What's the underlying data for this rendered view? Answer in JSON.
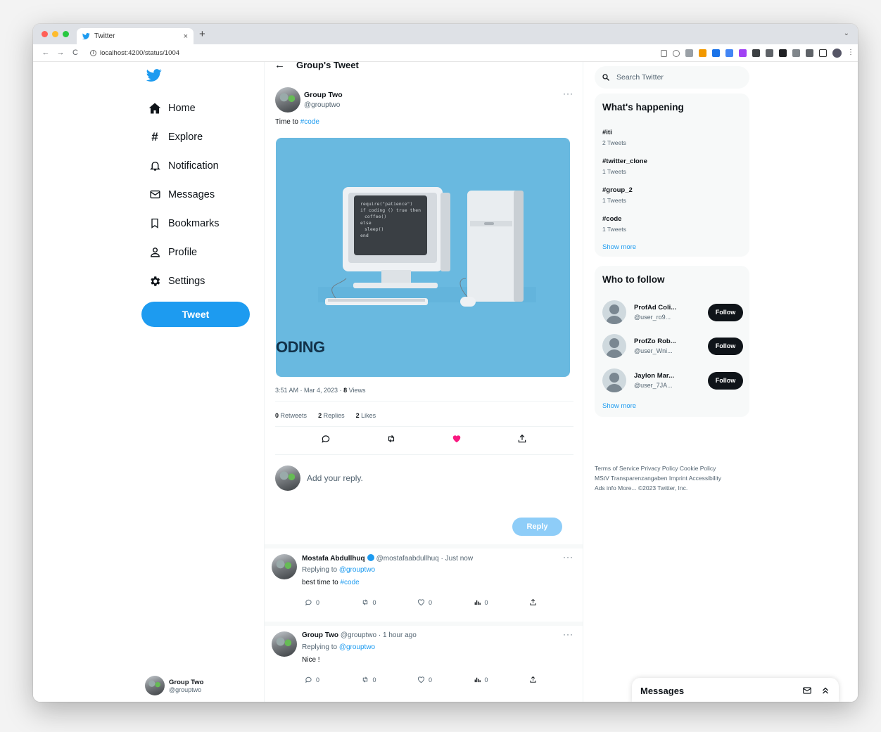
{
  "browser": {
    "tab_title": "Twitter",
    "new_tab": "+",
    "tab_close": "×",
    "url": "localhost:4200/status/1004"
  },
  "nav": {
    "items": [
      {
        "label": "Home",
        "icon": "home-icon"
      },
      {
        "label": "Explore",
        "icon": "hashtag-icon"
      },
      {
        "label": "Notification",
        "icon": "bell-icon"
      },
      {
        "label": "Messages",
        "icon": "envelope-icon"
      },
      {
        "label": "Bookmarks",
        "icon": "bookmark-icon"
      },
      {
        "label": "Profile",
        "icon": "user-icon"
      },
      {
        "label": "Settings",
        "icon": "gear-icon"
      }
    ],
    "tweet_button": "Tweet"
  },
  "account": {
    "name": "Group Two",
    "handle": "@grouptwo"
  },
  "header": {
    "title": "Group's Tweet"
  },
  "post": {
    "author_name": "Group Two",
    "author_handle": "@grouptwo",
    "text_prefix": "Time to ",
    "hashtag": "#code",
    "image_caption": "ODING",
    "time": "3:51 AM",
    "date": "Mar 4, 2023",
    "views_count": "8",
    "views_label": "Views",
    "retweets_count": "0",
    "retweets_label": "Retweets",
    "replies_count": "2",
    "replies_label": "Replies",
    "likes_count": "2",
    "likes_label": "Likes",
    "liked": true
  },
  "reply_box": {
    "placeholder": "Add your reply.",
    "button": "Reply"
  },
  "replies": [
    {
      "name": "Mostafa Abdullhuq",
      "verified": true,
      "rest": "@mostafaabdullhuq · Just now",
      "replying_label": "Replying to ",
      "replying_to": "@grouptwo",
      "text_prefix": "best time to ",
      "hashtag": "#code",
      "comments": "0",
      "retweets": "0",
      "likes": "0",
      "views": "0"
    },
    {
      "name": "Group Two",
      "verified": false,
      "rest": "@grouptwo · 1 hour ago",
      "replying_label": "Replying to ",
      "replying_to": "@grouptwo",
      "text_prefix": "Nice !",
      "hashtag": "",
      "comments": "0",
      "retweets": "0",
      "likes": "0",
      "views": "0"
    }
  ],
  "search": {
    "placeholder": "Search Twitter"
  },
  "trends": {
    "title": "What's happening",
    "items": [
      {
        "tag": "#iti",
        "count": "2 Tweets"
      },
      {
        "tag": "#twitter_clone",
        "count": "1 Tweets"
      },
      {
        "tag": "#group_2",
        "count": "1 Tweets"
      },
      {
        "tag": "#code",
        "count": "1 Tweets"
      }
    ],
    "show_more": "Show more"
  },
  "who_to_follow": {
    "title": "Who to follow",
    "items": [
      {
        "name": "ProfAd Coli...",
        "handle": "@user_ro9...",
        "button": "Follow"
      },
      {
        "name": "ProfZo Rob...",
        "handle": "@user_Wni...",
        "button": "Follow"
      },
      {
        "name": "Jaylon Mar...",
        "handle": "@user_7JA...",
        "button": "Follow"
      }
    ],
    "show_more": "Show more"
  },
  "footer": {
    "line1": "Terms of Service  Privacy Policy  Cookie Policy",
    "line2": "MStV Transparenzangaben  Imprint  Accessibility",
    "line3": "Ads info  More...  ©2023 Twitter, Inc."
  },
  "messages_bar": {
    "label": "Messages"
  },
  "colors": {
    "accent": "#1d9bf0",
    "like": "#f91880",
    "media_bg": "#69b9e0"
  }
}
